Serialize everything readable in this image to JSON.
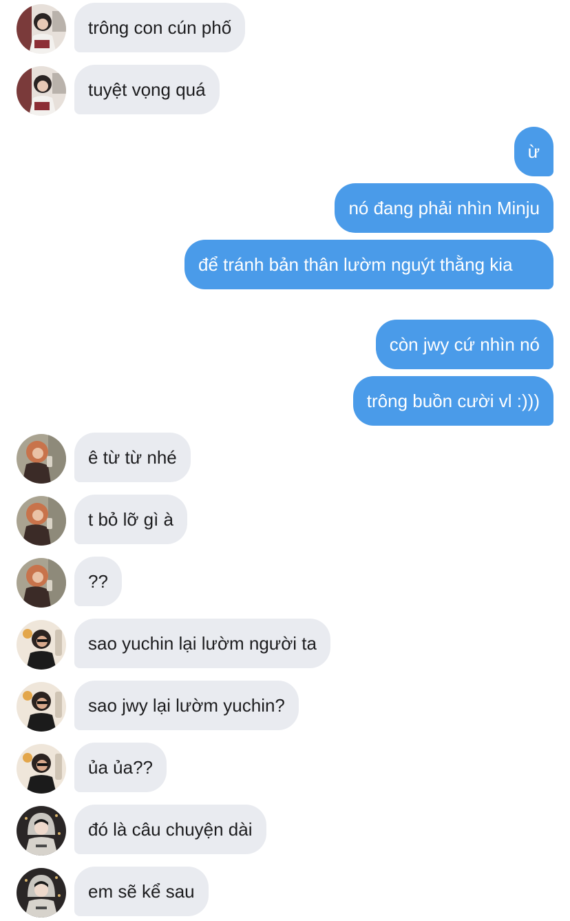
{
  "conversation": {
    "colors": {
      "incoming_bubble": "#e9ebf0",
      "outgoing_bubble": "#4a9be9",
      "incoming_text": "#1c1c1e",
      "outgoing_text": "#ffffff"
    },
    "messages": [
      {
        "direction": "incoming",
        "sender": "user-1",
        "text": "trông con cún phố"
      },
      {
        "direction": "incoming",
        "sender": "user-1",
        "text": "tuyệt vọng quá"
      },
      {
        "direction": "outgoing",
        "text": "ừ"
      },
      {
        "direction": "outgoing",
        "text": "nó đang phải nhìn Minju"
      },
      {
        "direction": "outgoing",
        "text": "để tránh bản thân lườm nguýt thằng kia"
      },
      {
        "direction": "outgoing",
        "text": "còn jwy cứ nhìn nó"
      },
      {
        "direction": "outgoing",
        "text": "trông buồn cười vl :)))"
      },
      {
        "direction": "incoming",
        "sender": "user-2",
        "text": "ê từ từ nhé"
      },
      {
        "direction": "incoming",
        "sender": "user-2",
        "text": "t bỏ lỡ gì à"
      },
      {
        "direction": "incoming",
        "sender": "user-2",
        "text": "??"
      },
      {
        "direction": "incoming",
        "sender": "user-3",
        "text": "sao yuchin lại lườm người ta"
      },
      {
        "direction": "incoming",
        "sender": "user-3",
        "text": "sao jwy lại lườm yuchin?"
      },
      {
        "direction": "incoming",
        "sender": "user-3",
        "text": "ủa ủa??"
      },
      {
        "direction": "incoming",
        "sender": "user-4",
        "text": "đó là câu chuyện dài"
      },
      {
        "direction": "incoming",
        "sender": "user-4",
        "text": "em sẽ kể sau"
      }
    ]
  }
}
